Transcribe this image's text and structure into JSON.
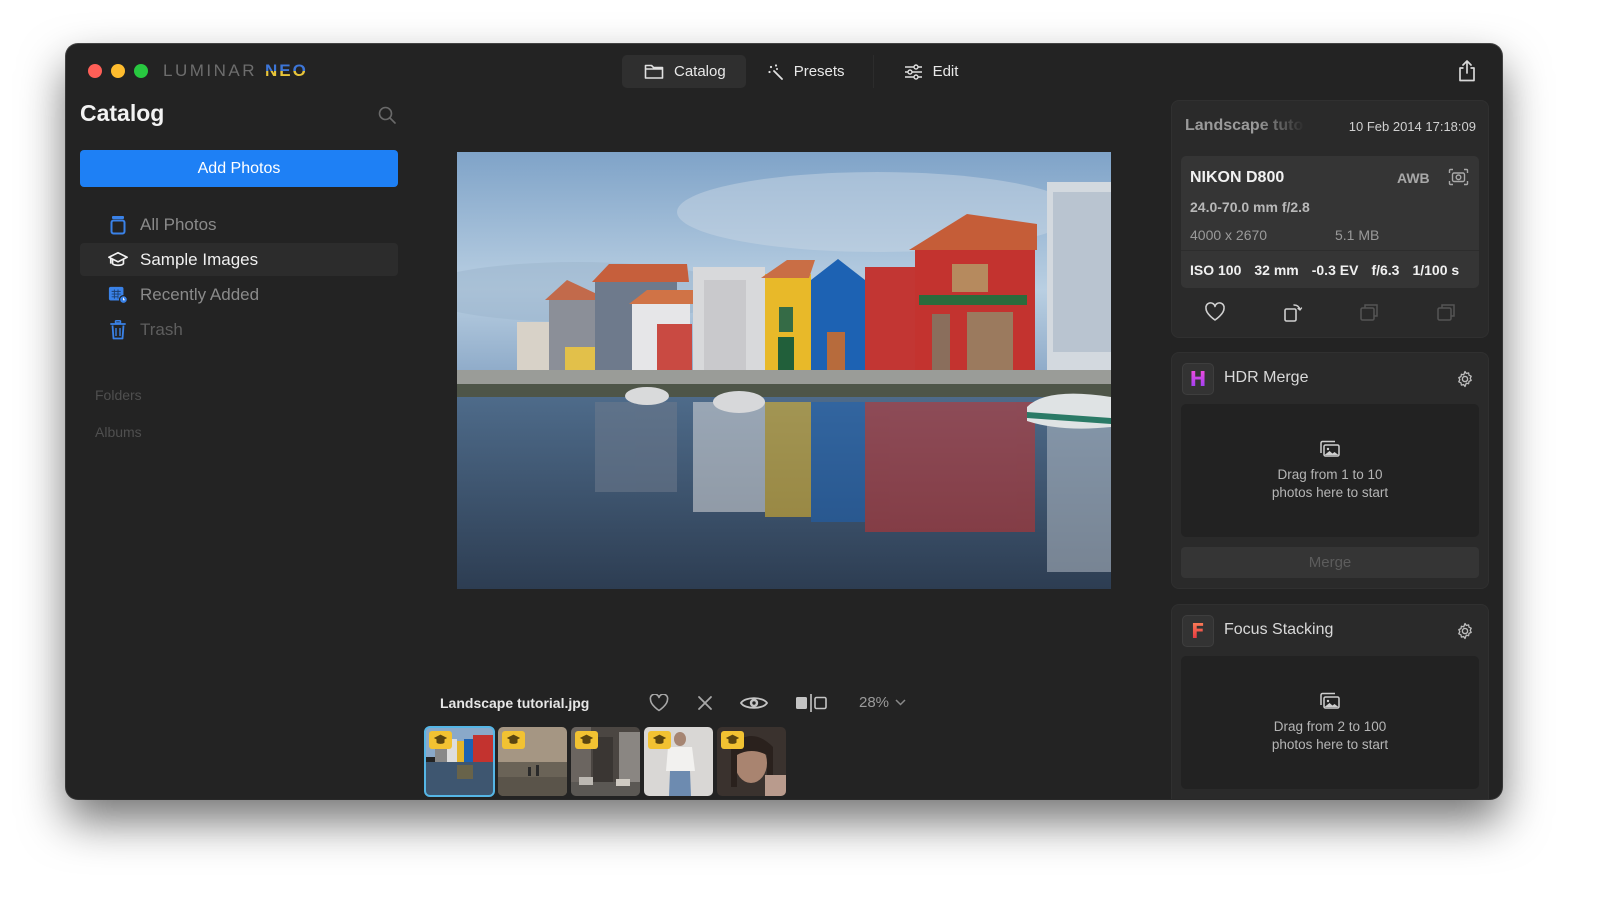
{
  "app": {
    "logo_main": "LUMINAR",
    "logo_accent": "NEO",
    "colors": {
      "accent_blue": "#1e80f5",
      "window_bg": "#232323",
      "selection_outline": "#55b6e6",
      "badge_yellow": "#f2c232"
    }
  },
  "topnav": {
    "tabs": [
      {
        "label": "Catalog",
        "icon": "folder-icon",
        "active": true
      },
      {
        "label": "Presets",
        "icon": "magic-wand-icon",
        "active": false
      },
      {
        "label": "Edit",
        "icon": "sliders-icon",
        "active": false
      }
    ],
    "share_icon": "share-icon"
  },
  "sidebar": {
    "title": "Catalog",
    "search_icon": "search-icon",
    "add_photos_label": "Add Photos",
    "items": [
      {
        "label": "All Photos",
        "icon": "all-photos-icon",
        "active": false
      },
      {
        "label": "Sample Images",
        "icon": "graduation-cap-icon",
        "active": true
      },
      {
        "label": "Recently Added",
        "icon": "calendar-clock-icon",
        "active": false
      },
      {
        "label": "Trash",
        "icon": "trash-icon",
        "active": false
      }
    ],
    "sections": {
      "folders": "Folders",
      "albums": "Albums"
    }
  },
  "viewer": {
    "filename": "Landscape tutorial.jpg",
    "zoom_level": "28%",
    "tools": [
      "favorite-icon",
      "reject-icon",
      "preview-eye-icon",
      "compare-split-icon"
    ]
  },
  "filmstrip": {
    "thumbnails": [
      {
        "subject": "Colorful canal houses",
        "selected": true,
        "badge": "graduation-cap-icon"
      },
      {
        "subject": "Beach at sunset",
        "selected": false,
        "badge": "graduation-cap-icon"
      },
      {
        "subject": "City street",
        "selected": false,
        "badge": "graduation-cap-icon"
      },
      {
        "subject": "Woman in white top",
        "selected": false,
        "badge": "graduation-cap-icon"
      },
      {
        "subject": "Portrait of woman",
        "selected": false,
        "badge": "graduation-cap-icon"
      }
    ]
  },
  "info_panel": {
    "name": "Landscape tutorial.jpg",
    "name_visible": "Landscape tuto",
    "date": "10 Feb 2014 17:18:09",
    "camera": "NIKON D800",
    "white_balance": "AWB",
    "lens": "24.0-70.0 mm f/2.8",
    "dimensions": "4000 x 2670",
    "file_size": "5.1 MB",
    "settings": {
      "iso": "ISO 100",
      "focal": "32 mm",
      "ev": "-0.3 EV",
      "aperture": "f/6.3",
      "shutter": "1/100 s"
    }
  },
  "tools": {
    "hdr": {
      "icon_letter": "H",
      "name": "HDR Merge",
      "drop_text_1": "Drag from 1 to 10",
      "drop_text_2": "photos here to start",
      "merge_label": "Merge"
    },
    "focus": {
      "icon_letter": "F",
      "name": "Focus Stacking",
      "drop_text_1": "Drag from 2 to 100",
      "drop_text_2": "photos here to start"
    }
  }
}
